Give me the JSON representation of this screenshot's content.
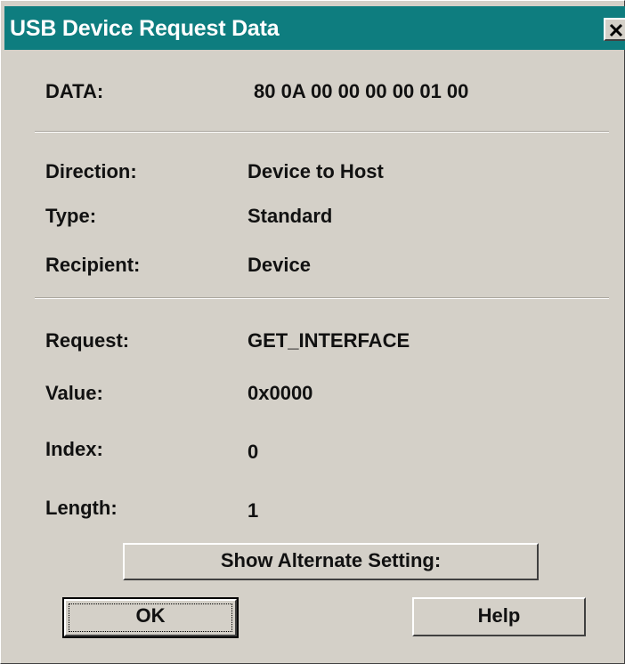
{
  "window": {
    "title": "USB Device Request Data"
  },
  "data_row": {
    "label": "DATA:",
    "value": "80 0A 00 00 00 00 01 00"
  },
  "fields": {
    "direction": {
      "label": "Direction:",
      "value": "Device to Host"
    },
    "type": {
      "label": "Type:",
      "value": "Standard"
    },
    "recipient": {
      "label": "Recipient:",
      "value": "Device"
    },
    "request": {
      "label": "Request:",
      "value": "GET_INTERFACE"
    },
    "value": {
      "label": "Value:",
      "value": "0x0000"
    },
    "index": {
      "label": "Index:",
      "value": "0"
    },
    "length": {
      "label": "Length:",
      "value": "1"
    }
  },
  "buttons": {
    "show_alternate": "Show Alternate Setting:",
    "ok": "OK",
    "help": "Help",
    "close_icon": "close-x-icon"
  },
  "colors": {
    "titlebar": "#0e7d7f",
    "dialog_bg": "#d4d0c8"
  }
}
